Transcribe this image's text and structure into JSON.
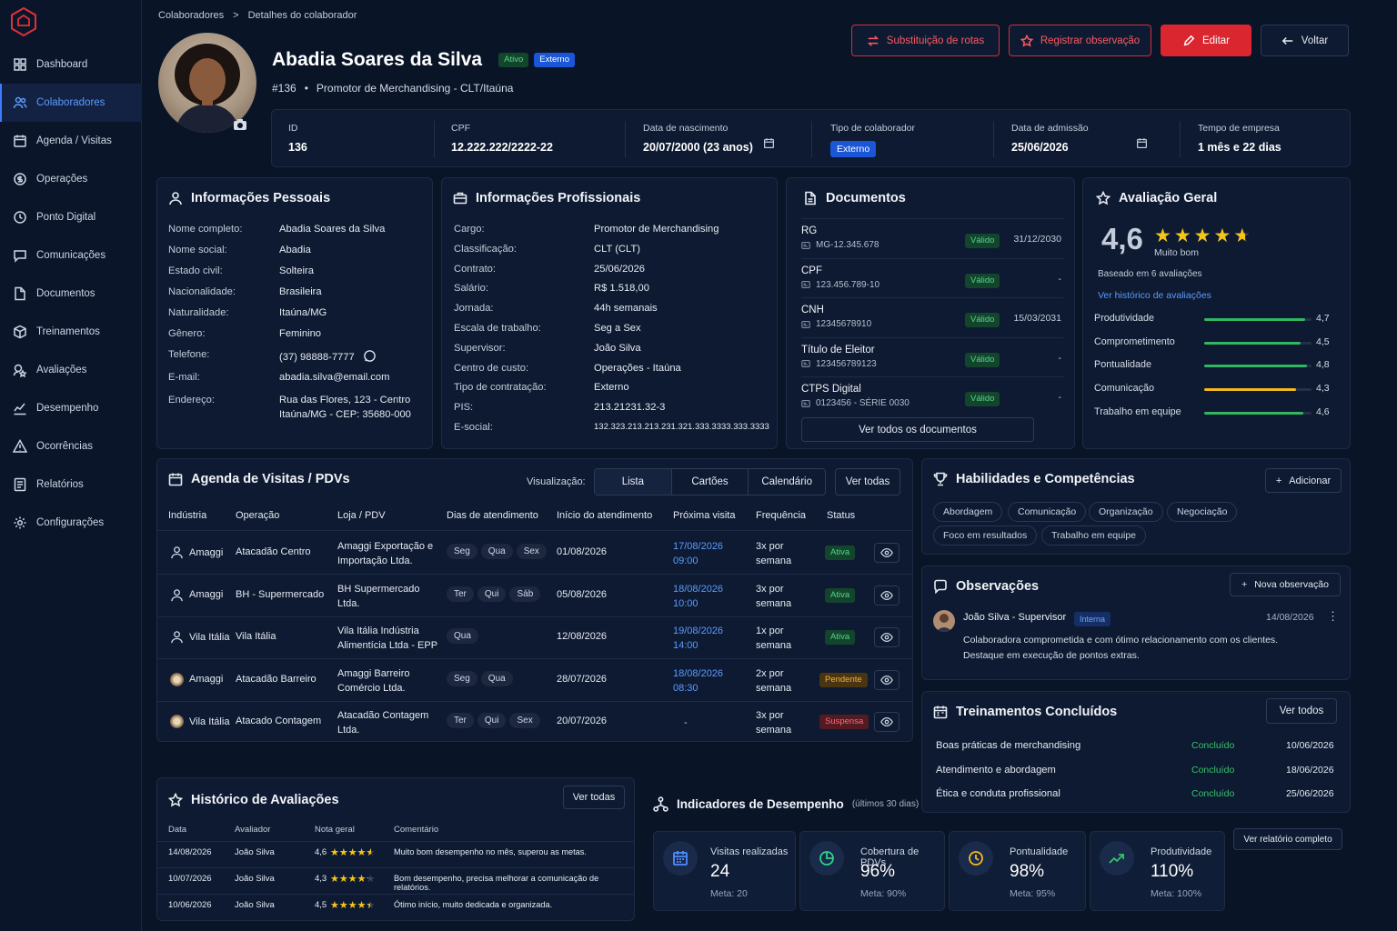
{
  "sidebar": {
    "items": [
      {
        "label": "Dashboard",
        "icon": "dashboard-icon"
      },
      {
        "label": "Colaboradores",
        "icon": "users-icon",
        "active": true
      },
      {
        "label": "Agenda / Visitas",
        "icon": "calendar-icon"
      },
      {
        "label": "Operações",
        "icon": "coin-icon"
      },
      {
        "label": "Ponto Digital",
        "icon": "clock-icon"
      },
      {
        "label": "Comunicações",
        "icon": "chat-icon"
      },
      {
        "label": "Documentos",
        "icon": "document-icon"
      },
      {
        "label": "Treinamentos",
        "icon": "box-icon"
      },
      {
        "label": "Avaliações",
        "icon": "rating-icon"
      },
      {
        "label": "Desempenho",
        "icon": "chart-icon"
      },
      {
        "label": "Ocorrências",
        "icon": "warning-icon"
      },
      {
        "label": "Relatórios",
        "icon": "report-icon"
      },
      {
        "label": "Configurações",
        "icon": "gear-icon"
      }
    ]
  },
  "breadcrumb": {
    "root": "Colaboradores",
    "sep": ">",
    "current": "Detalhes do colaborador"
  },
  "profile": {
    "name": "Abadia Soares da Silva",
    "status": "Ativo",
    "type": "Externo",
    "subtitle_id": "#136",
    "subtitle_sep": "•",
    "subtitle_role": "Promotor de Merchandising - CLT/Itaúna"
  },
  "actions": {
    "routes": "Substituição de rotas",
    "observe": "Registrar observação",
    "edit": "Editar",
    "back": "Voltar"
  },
  "summary": [
    {
      "label": "ID",
      "value": "136"
    },
    {
      "label": "CPF",
      "value": "12.222.222/2222-22"
    },
    {
      "label": "Data de nascimento",
      "value": "20/07/2000 (23 anos)"
    },
    {
      "label": "Tipo de colaborador",
      "value": "Externo"
    },
    {
      "label": "Data de admissão",
      "value": "25/06/2026"
    },
    {
      "label": "Tempo de empresa",
      "value": "1 mês e 22 dias"
    }
  ],
  "personal": {
    "title": "Informações Pessoais",
    "rows": [
      {
        "k": "Nome completo:",
        "v": "Abadia Soares da Silva"
      },
      {
        "k": "Nome social:",
        "v": "Abadia"
      },
      {
        "k": "Estado civil:",
        "v": "Solteira"
      },
      {
        "k": "Nacionalidade:",
        "v": "Brasileira"
      },
      {
        "k": "Naturalidade:",
        "v": "Itaúna/MG"
      },
      {
        "k": "Gênero:",
        "v": "Feminino"
      },
      {
        "k": "Telefone:",
        "v": "(37) 98888-7777"
      },
      {
        "k": "E-mail:",
        "v": "abadia.silva@email.com"
      },
      {
        "k": "Endereço:",
        "v": "Rua das Flores, 123 - Centro",
        "v2": "Itaúna/MG - CEP: 35680-000"
      }
    ]
  },
  "professional": {
    "title": "Informações Profissionais",
    "rows": [
      {
        "k": "Cargo:",
        "v": "Promotor de Merchandising"
      },
      {
        "k": "Classificação:",
        "v": "CLT (CLT)"
      },
      {
        "k": "Contrato:",
        "v": "25/06/2026"
      },
      {
        "k": "Salário:",
        "v": "R$ 1.518,00"
      },
      {
        "k": "Jornada:",
        "v": "44h semanais"
      },
      {
        "k": "Escala de trabalho:",
        "v": "Seg a Sex"
      },
      {
        "k": "Supervisor:",
        "v": "João Silva"
      },
      {
        "k": "Centro de custo:",
        "v": "Operações - Itaúna"
      },
      {
        "k": "Tipo de contratação:",
        "v": "Externo"
      },
      {
        "k": "PIS:",
        "v": "213.21231.32-3"
      },
      {
        "k": "E-social:",
        "v": "132.323.213.213.231.321.333.3333.333.3333"
      }
    ]
  },
  "documents": {
    "title": "Documentos",
    "items": [
      {
        "name": "RG",
        "num": "MG-12.345.678",
        "status": "Válido",
        "date": "31/12/2030"
      },
      {
        "name": "CPF",
        "num": "123.456.789-10",
        "status": "Válido",
        "date": "-"
      },
      {
        "name": "CNH",
        "num": "12345678910",
        "status": "Válido",
        "date": "15/03/2031"
      },
      {
        "name": "Título de Eleitor",
        "num": "123456789123",
        "status": "Válido",
        "date": "-"
      },
      {
        "name": "CTPS Digital",
        "num": "0123456 - SÉRIE 0030",
        "status": "Válido",
        "date": "-"
      }
    ],
    "button": "Ver todos os documentos"
  },
  "rating": {
    "title": "Avaliação Geral",
    "score": "4,6",
    "score_value": 4.6,
    "label": "Muito bom",
    "based": "Baseado em 6 avaliações",
    "history_link": "Ver histórico de avaliações",
    "criteria": [
      {
        "name": "Produtividade",
        "value": "4,7",
        "num": 4.7,
        "color": "#32b660"
      },
      {
        "name": "Comprometimento",
        "value": "4,5",
        "num": 4.5,
        "color": "#32b660"
      },
      {
        "name": "Pontualidade",
        "value": "4,8",
        "num": 4.8,
        "color": "#32b660"
      },
      {
        "name": "Comunicação",
        "value": "4,3",
        "num": 4.3,
        "color": "#f5b81f"
      },
      {
        "name": "Trabalho em equipe",
        "value": "4,6",
        "num": 4.6,
        "color": "#32b660"
      }
    ]
  },
  "agenda": {
    "title": "Agenda de Visitas / PDVs",
    "view_label": "Visualização:",
    "views": [
      "Lista",
      "Cartões",
      "Calendário"
    ],
    "see_all": "Ver todas",
    "headers": [
      "Indústria",
      "Operação",
      "Loja / PDV",
      "Dias de atendimento",
      "Início do atendimento",
      "Próxima visita",
      "Frequência",
      "Status"
    ],
    "rows": [
      {
        "industry": "Amaggi",
        "operation": "Atacadão Centro",
        "store1": "Amaggi Exportação e",
        "store2": "Importação Ltda.",
        "days": [
          "Seg",
          "Qua",
          "Sex"
        ],
        "start": "01/08/2026",
        "next1": "17/08/2026",
        "next2": "09:00",
        "freq1": "3x por",
        "freq2": "semana",
        "status": "Ativa",
        "st": "green",
        "avatar": "user-icon"
      },
      {
        "industry": "Amaggi",
        "operation": "BH - Supermercado",
        "store1": "BH Supermercado",
        "store2": "Ltda.",
        "days": [
          "Ter",
          "Qui",
          "Sáb"
        ],
        "start": "05/08/2026",
        "next1": "18/08/2026",
        "next2": "10:00",
        "freq1": "3x por",
        "freq2": "semana",
        "status": "Ativa",
        "st": "green",
        "avatar": "user-icon"
      },
      {
        "industry": "Vila Itália",
        "operation": "Vila Itália",
        "store1": "Vila Itália Indústria",
        "store2": "Alimentícia Ltda - EPP",
        "days": [
          "Qua"
        ],
        "start": "12/08/2026",
        "next1": "19/08/2026",
        "next2": "14:00",
        "freq1": "1x por",
        "freq2": "semana",
        "status": "Ativa",
        "st": "green",
        "avatar": "user-icon"
      },
      {
        "industry": "Amaggi",
        "operation": "Atacadão Barreiro",
        "store1": "Amaggi Barreiro",
        "store2": "Comércio Ltda.",
        "days": [
          "Seg",
          "Qua"
        ],
        "start": "28/07/2026",
        "next1": "18/08/2026",
        "next2": "08:30",
        "freq1": "2x por",
        "freq2": "semana",
        "status": "Pendente",
        "st": "amber",
        "avatar": "brand-logo-icon"
      },
      {
        "industry": "Vila Itália",
        "operation": "Atacado Contagem",
        "store1": "Atacadão Contagem",
        "store2": "Ltda.",
        "days": [
          "Ter",
          "Qui",
          "Sex"
        ],
        "start": "20/07/2026",
        "next1": "-",
        "next2": "",
        "freq1": "3x por",
        "freq2": "semana",
        "status": "Suspensa",
        "st": "red",
        "avatar": "brand-logo-icon"
      }
    ]
  },
  "skills": {
    "title": "Habilidades e Competências",
    "add": "Adicionar",
    "items": [
      "Abordagem",
      "Comunicação",
      "Organização",
      "Negociação",
      "Foco em resultados",
      "Trabalho em equipe"
    ]
  },
  "observations": {
    "title": "Observações",
    "new": "Nova observação",
    "author": "João Silva - Supervisor",
    "tag": "Interna",
    "date": "14/08/2026",
    "text1": "Colaboradora comprometida e com ótimo relacionamento com os clientes.",
    "text2": "Destaque em execução de pontos extras."
  },
  "trainings": {
    "title": "Treinamentos Concluídos",
    "see_all": "Ver todos",
    "items": [
      {
        "name": "Boas práticas de merchandising",
        "status": "Concluído",
        "date": "10/06/2026"
      },
      {
        "name": "Atendimento e abordagem",
        "status": "Concluído",
        "date": "18/06/2026"
      },
      {
        "name": "Ética e conduta profissional",
        "status": "Concluído",
        "date": "25/06/2026"
      }
    ]
  },
  "history": {
    "title": "Histórico de Avaliações",
    "see_all": "Ver todas",
    "headers": [
      "Data",
      "Avaliador",
      "Nota geral",
      "Comentário"
    ],
    "rows": [
      {
        "date": "14/08/2026",
        "by": "João Silva",
        "score": "4,6",
        "stars": 4.6,
        "comment": "Muito bom desempenho no mês, superou as metas."
      },
      {
        "date": "10/07/2026",
        "by": "João Silva",
        "score": "4,3",
        "stars": 4.3,
        "comment": "Bom desempenho, precisa melhorar a comunicação de relatórios."
      },
      {
        "date": "10/06/2026",
        "by": "João Silva",
        "score": "4,5",
        "stars": 4.5,
        "comment": "Ótimo início, muito dedicada e organizada."
      }
    ]
  },
  "indicators": {
    "title": "Indicadores de Desempenho",
    "period": "(últimos 30 dias)",
    "report": "Ver relatório completo",
    "items": [
      {
        "label": "Visitas realizadas",
        "value": "24",
        "meta": "Meta: 20",
        "icon": "calendar-icon",
        "color": "#4d8dff"
      },
      {
        "label": "Cobertura de PDVs",
        "value": "96%",
        "meta": "Meta: 90%",
        "icon": "pie-icon",
        "color": "#2fd18a"
      },
      {
        "label": "Pontualidade",
        "value": "98%",
        "meta": "Meta: 95%",
        "icon": "clock-icon",
        "color": "#f5b81f"
      },
      {
        "label": "Produtividade",
        "value": "110%",
        "meta": "Meta: 100%",
        "icon": "trend-icon",
        "color": "#35c46a"
      }
    ]
  }
}
